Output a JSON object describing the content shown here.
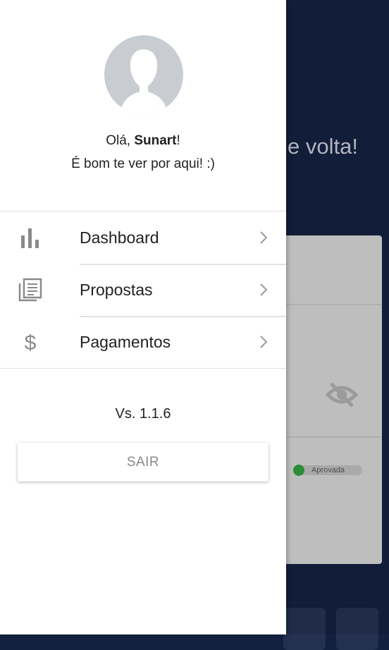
{
  "background": {
    "title_fragment": "e volta!",
    "status_label": "Aprovada",
    "status_color": "#2f9b3c"
  },
  "drawer": {
    "greeting_prefix": "Olá, ",
    "user_name": "Sunart",
    "greeting_suffix": "!",
    "subtitle": "É bom te ver por aqui! :)",
    "menu": [
      {
        "label": "Dashboard",
        "icon": "bar-chart-icon"
      },
      {
        "label": "Propostas",
        "icon": "document-list-icon"
      },
      {
        "label": "Pagamentos",
        "icon": "dollar-icon"
      }
    ],
    "version": "Vs. 1.1.6",
    "logout_label": "SAIR"
  }
}
